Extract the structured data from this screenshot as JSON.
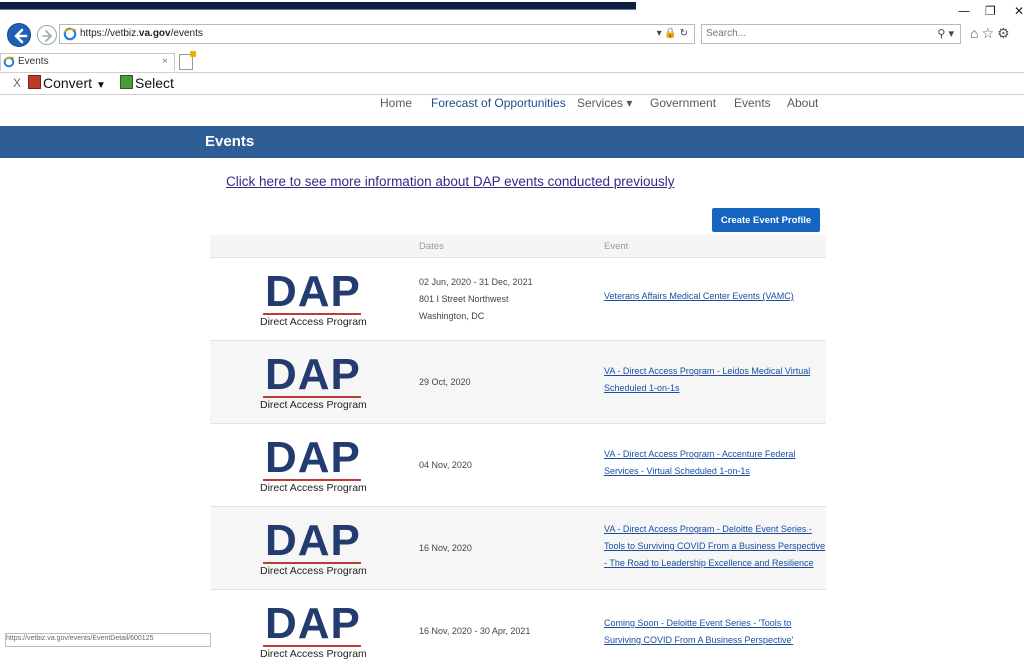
{
  "browser": {
    "url_prefix": "https://vetbiz.",
    "url_domain": "va.gov",
    "url_path": "/events",
    "search_placeholder": "Search...",
    "tab_title": "Events",
    "tab_close": "×",
    "toolbar_x": "X",
    "convert_label": "Convert",
    "select_label": "Select",
    "status_text": "https://vetbiz.va.gov/events/EventDetail/600125"
  },
  "nav": {
    "items": [
      {
        "label": "Home"
      },
      {
        "label": "Forecast of Opportunities"
      },
      {
        "label": "Services ▾"
      },
      {
        "label": "Government"
      },
      {
        "label": "Events"
      },
      {
        "label": "About"
      }
    ]
  },
  "page": {
    "title": "Events",
    "more_link": "Click here to see more information about DAP events conducted previously",
    "create_button": "Create Event Profile"
  },
  "table": {
    "headers": {
      "dates": "Dates",
      "event": "Event"
    },
    "logo": {
      "letters": "DAP",
      "subtitle": "Direct Access Program"
    },
    "rows": [
      {
        "dates": [
          "02 Jun, 2020 - 31 Dec, 2021",
          "801 I Street Northwest",
          "Washington, DC"
        ],
        "event": "Veterans Affairs Medical Center Events (VAMC)"
      },
      {
        "dates": [
          "29 Oct, 2020"
        ],
        "event": "VA - Direct Access Program - Leidos Medical Virtual Scheduled 1-on-1s"
      },
      {
        "dates": [
          "04 Nov, 2020"
        ],
        "event": "VA - Direct Access Program - Accenture Federal Services - Virtual Scheduled 1-on-1s"
      },
      {
        "dates": [
          "16 Nov, 2020"
        ],
        "event": "VA - Direct Access Program - Deloitte Event Series - Tools to Surviving COVID From a Business Perspective - The Road to Leadership Excellence and Resilience"
      },
      {
        "dates": [
          "16 Nov, 2020 - 30 Apr, 2021"
        ],
        "event": "Coming Soon - Deloitte Event Series - 'Tools to Surviving COVID From A Business Perspective'"
      }
    ]
  },
  "colors": {
    "banner": "#2f5e97",
    "button": "#1565c0",
    "link": "#1a4fa0",
    "dap_blue": "#233b6e",
    "dap_red": "#c23a35"
  }
}
